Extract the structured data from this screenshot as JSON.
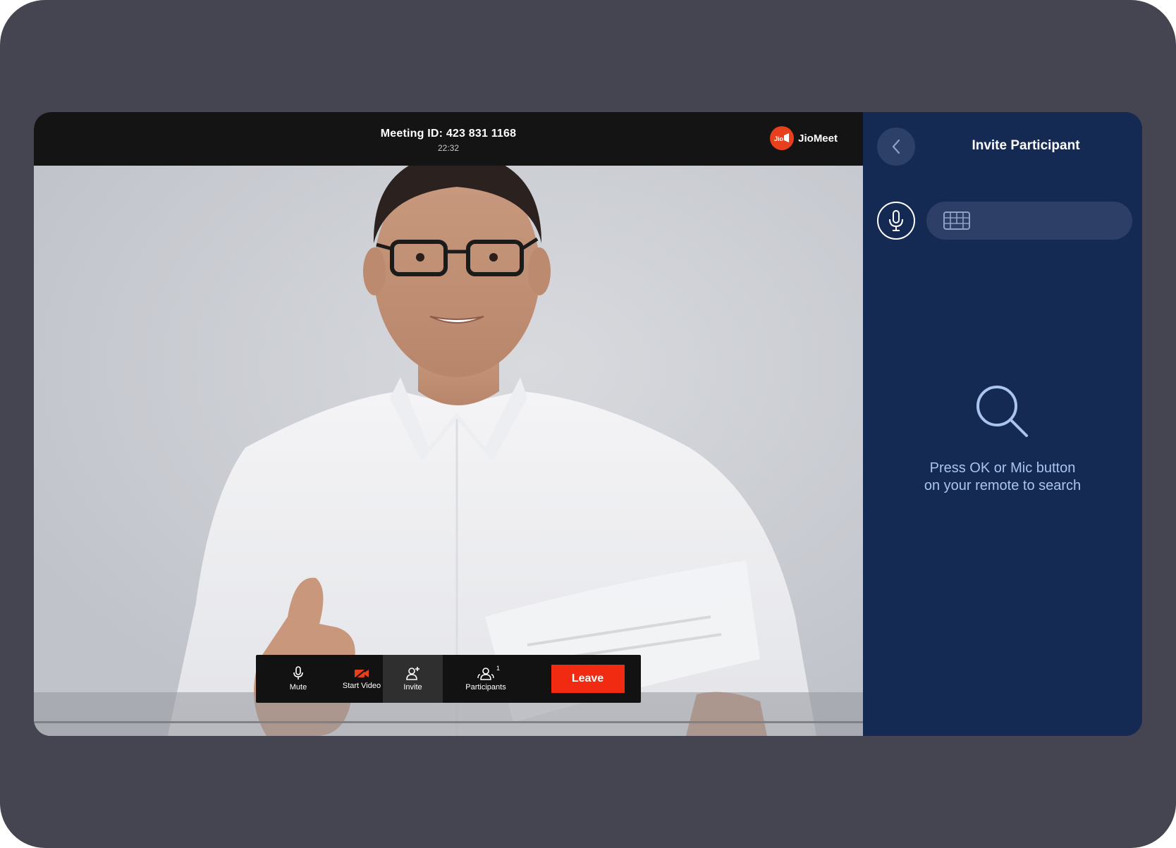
{
  "meeting": {
    "id_label": "Meeting ID: 423 831 1168",
    "time": "22:32",
    "brand": "JioMeet",
    "brand_logo_text": "Jio"
  },
  "toolbar": {
    "mute_label": "Mute",
    "video_label": "Start Video",
    "invite_label": "Invite",
    "participants_label": "Participants",
    "participants_count": "1",
    "leave_label": "Leave"
  },
  "panel": {
    "title": "Invite Participant",
    "search_placeholder": "",
    "hint_line1": "Press OK or Mic button",
    "hint_line2": "on your remote to search"
  },
  "colors": {
    "frame": "#454551",
    "panel_bg": "#152a52",
    "leave": "#f02b12",
    "brand": "#e8401c",
    "hint_text": "#a9c4ef"
  },
  "icons": [
    "mic-icon",
    "video-off-icon",
    "add-person-icon",
    "participants-icon",
    "chevron-left-icon",
    "keyboard-icon",
    "search-icon"
  ]
}
